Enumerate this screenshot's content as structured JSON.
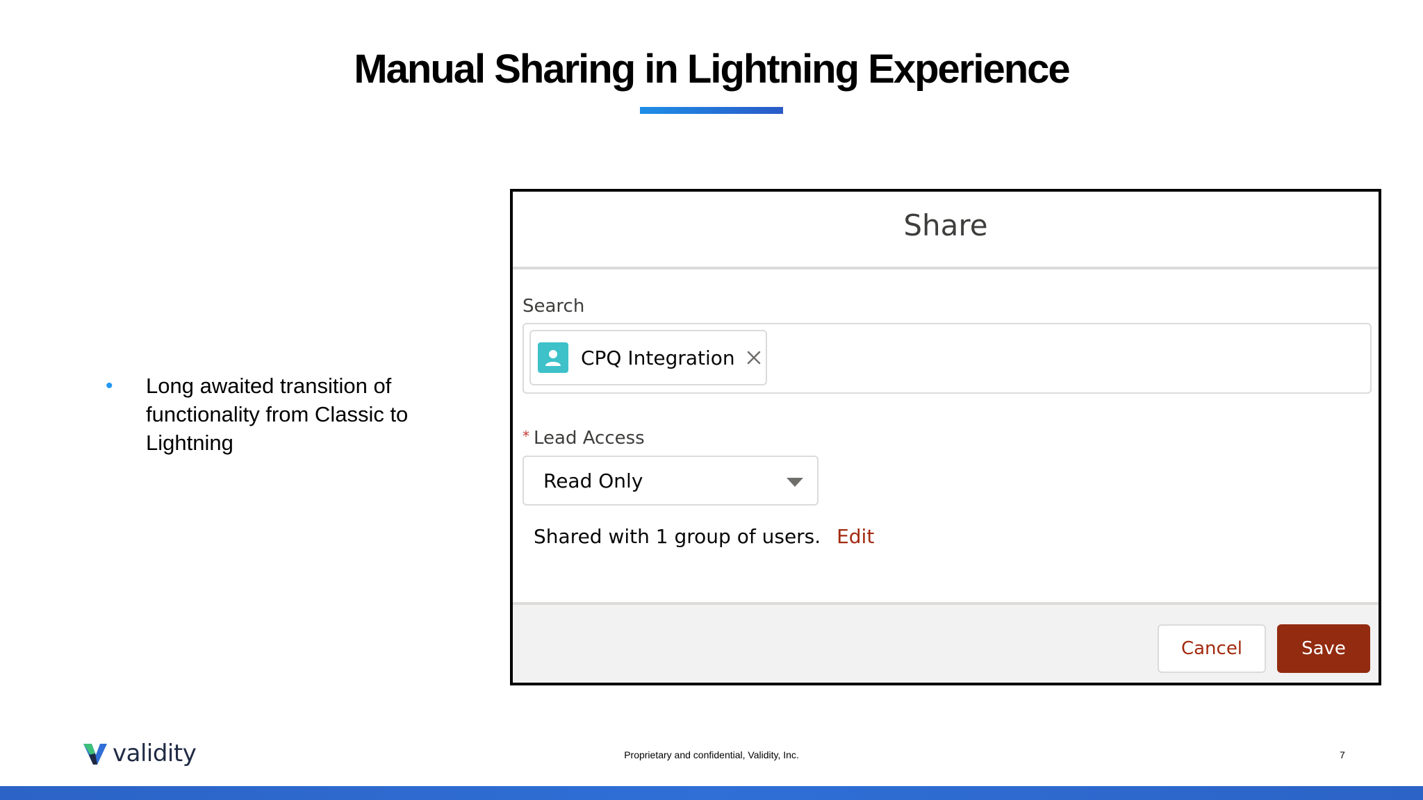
{
  "slide": {
    "title": "Manual Sharing in Lightning Experience",
    "bullets": [
      "Long awaited transition of functionality from Classic to Lightning"
    ],
    "footer_note": "Proprietary and confidential, Validity, Inc.",
    "page_number": "7",
    "logo_text": "validity"
  },
  "share_dialog": {
    "title": "Share",
    "search": {
      "label": "Search",
      "selected_pill": "CPQ Integration"
    },
    "lead_access": {
      "required_marker": "*",
      "label": "Lead Access",
      "selected_value": "Read Only"
    },
    "shared_with_text": "Shared with 1 group of users.",
    "edit_link": "Edit",
    "buttons": {
      "cancel": "Cancel",
      "save": "Save"
    }
  },
  "colors": {
    "bullet": "#2196f3",
    "link_red": "#a32a0f",
    "save_button": "#922b10",
    "avatar_teal": "#3ec1c9",
    "bottom_bar": "#2c63c6"
  },
  "icons": {
    "pill_avatar": "user-icon",
    "pill_remove": "close-icon",
    "select_caret": "chevron-down-icon",
    "logo_mark": "validity-logo-icon"
  }
}
